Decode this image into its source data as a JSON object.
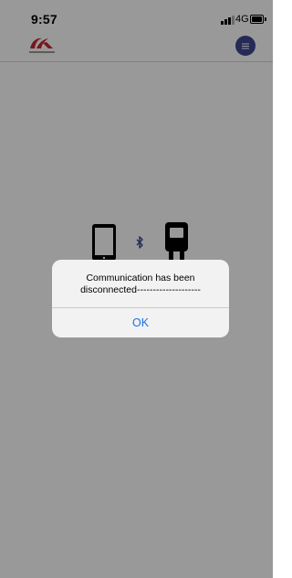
{
  "status_bar": {
    "time": "9:57",
    "network": "4G"
  },
  "header": {
    "logo_icon": "company-logo",
    "menu_icon": "hamburger-menu-icon",
    "menu_color": "#3e4791"
  },
  "content": {
    "graphic_icons": [
      "phone-icon",
      "bluetooth-icon",
      "meter-device-icon"
    ]
  },
  "alert": {
    "message": "Communication has been\ndisconnected--------------------",
    "ok_label": "OK",
    "button_color": "#1b72e8"
  }
}
